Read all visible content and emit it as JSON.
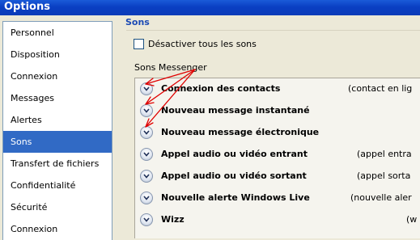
{
  "window": {
    "title": "Options"
  },
  "sidebar": {
    "items": [
      {
        "label": "Personnel",
        "selected": false
      },
      {
        "label": "Disposition",
        "selected": false
      },
      {
        "label": "Connexion",
        "selected": false
      },
      {
        "label": "Messages",
        "selected": false
      },
      {
        "label": "Alertes",
        "selected": false
      },
      {
        "label": "Sons",
        "selected": true
      },
      {
        "label": "Transfert de fichiers",
        "selected": false
      },
      {
        "label": "Confidentialité",
        "selected": false
      },
      {
        "label": "Sécurité",
        "selected": false
      },
      {
        "label": "Connexion",
        "selected": false
      }
    ]
  },
  "main": {
    "section_title": "Sons",
    "disable_all": {
      "label": "Désactiver tous les sons",
      "checked": false
    },
    "group_label": "Sons Messenger",
    "sounds": [
      {
        "name": "Connexion des contacts",
        "extra": "(contact en lig"
      },
      {
        "name": "Nouveau message instantané",
        "extra": ""
      },
      {
        "name": "Nouveau message électronique",
        "extra": ""
      },
      {
        "name": "Appel audio ou vidéo entrant",
        "extra": "(appel entra"
      },
      {
        "name": "Appel audio ou vidéo sortant",
        "extra": "(appel sorta"
      },
      {
        "name": "Nouvelle alerte Windows Live",
        "extra": "(nouvelle aler"
      },
      {
        "name": "Wizz",
        "extra": "(w"
      }
    ]
  },
  "colors": {
    "titlebar": "#0a3fc3",
    "section_title": "#1b4ab5",
    "selection": "#316ac5",
    "annotation_arrows": "#e00000"
  },
  "icons": {
    "sound_row": "chevron-down-icon"
  }
}
